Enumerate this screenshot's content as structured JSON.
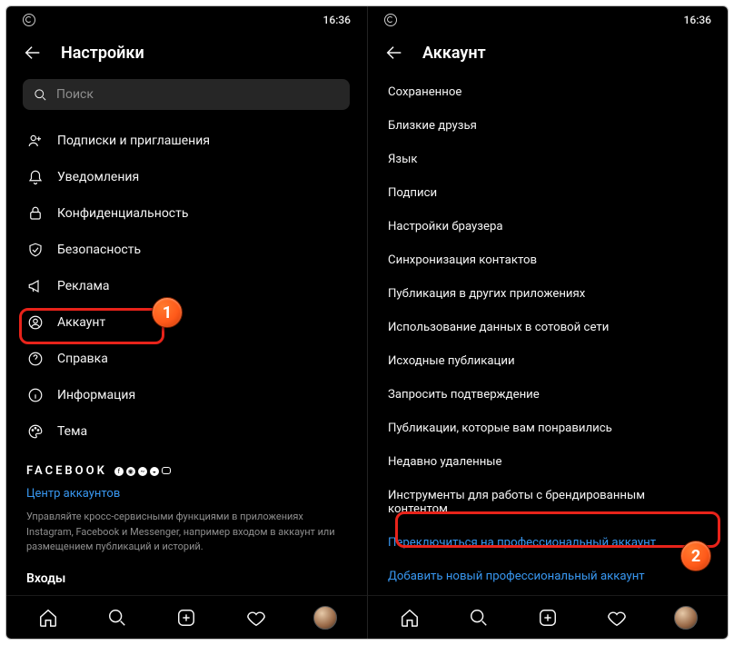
{
  "status": {
    "time": "16:36"
  },
  "left": {
    "title": "Настройки",
    "search_placeholder": "Поиск",
    "items": [
      {
        "label": "Подписки и приглашения"
      },
      {
        "label": "Уведомления"
      },
      {
        "label": "Конфиденциальность"
      },
      {
        "label": "Безопасность"
      },
      {
        "label": "Реклама"
      },
      {
        "label": "Аккаунт"
      },
      {
        "label": "Справка"
      },
      {
        "label": "Информация"
      },
      {
        "label": "Тема"
      }
    ],
    "brand": "FACEBOOK",
    "accounts_center": "Центр аккаунтов",
    "desc": "Управляйте кросс-сервисными функциями в приложениях Instagram, Facebook и Messenger, например входом в аккаунт или размещением публикаций и историй.",
    "logins_heading": "Входы"
  },
  "right": {
    "title": "Аккаунт",
    "items": [
      "Сохраненное",
      "Близкие друзья",
      "Язык",
      "Подписи",
      "Настройки браузера",
      "Синхронизация контактов",
      "Публикация в других приложениях",
      "Использование данных в сотовой сети",
      "Исходные публикации",
      "Запросить подтверждение",
      "Публикации, которые вам понравились",
      "Недавно удаленные",
      "Инструменты для работы с брендированным контентом"
    ],
    "switch_pro": "Переключиться на профессиональный аккаунт",
    "add_pro": "Добавить новый профессиональный аккаунт"
  },
  "annotations": {
    "badge1": "1",
    "badge2": "2"
  }
}
